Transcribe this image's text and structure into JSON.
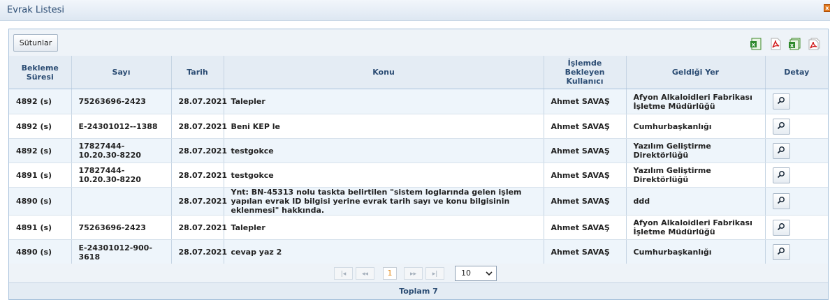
{
  "window": {
    "title": "Evrak Listesi",
    "close_label": "x"
  },
  "toolbar": {
    "columns_button": "Sütunlar",
    "export_icons": [
      "excel-icon",
      "pdf-icon",
      "excel-all-icon",
      "pdf-all-icon"
    ]
  },
  "table": {
    "headers": [
      "Bekleme Süresi",
      "Sayı",
      "Tarih",
      "Konu",
      "İşlemde Bekleyen Kullanıcı",
      "Geldiği Yer",
      "Detay"
    ],
    "rows": [
      {
        "wait": "4892 (s)",
        "number": "75263696-2423",
        "date": "28.07.2021",
        "subject": "Talepler",
        "user": "Ahmet SAVAŞ",
        "origin": "Afyon Alkaloidleri Fabrikası İşletme Müdürlüğü"
      },
      {
        "wait": "4892 (s)",
        "number": "E-24301012--1388",
        "date": "28.07.2021",
        "subject": "Beni KEP le",
        "user": "Ahmet SAVAŞ",
        "origin": "Cumhurbaşkanlığı"
      },
      {
        "wait": "4892 (s)",
        "number": "17827444-10.20.30-8220",
        "date": "28.07.2021",
        "subject": "testgokce",
        "user": "Ahmet SAVAŞ",
        "origin": "Yazılım Geliştirme Direktörlüğü"
      },
      {
        "wait": "4891 (s)",
        "number": "17827444-10.20.30-8220",
        "date": "28.07.2021",
        "subject": "testgokce",
        "user": "Ahmet SAVAŞ",
        "origin": "Yazılım Geliştirme Direktörlüğü"
      },
      {
        "wait": "4890 (s)",
        "number": "",
        "date": "28.07.2021",
        "subject": "Ynt: BN-45313 nolu taskta belirtilen \"sistem loglarında gelen işlem yapılan evrak ID bilgisi yerine evrak tarih sayı ve konu bilgisinin eklenmesi\" hakkında.",
        "user": "Ahmet SAVAŞ",
        "origin": "ddd"
      },
      {
        "wait": "4891 (s)",
        "number": "75263696-2423",
        "date": "28.07.2021",
        "subject": "Talepler",
        "user": "Ahmet SAVAŞ",
        "origin": "Afyon Alkaloidleri Fabrikası İşletme Müdürlüğü"
      },
      {
        "wait": "4890 (s)",
        "number": "E-24301012-900-3618",
        "date": "28.07.2021",
        "subject": "cevap yaz 2",
        "user": "Ahmet SAVAŞ",
        "origin": "Cumhurbaşkanlığı"
      }
    ]
  },
  "pager": {
    "first": "|◂",
    "prev": "◂◂",
    "current_page": "1",
    "next": "▸▸",
    "last": "▸|",
    "page_size": "10"
  },
  "footer": {
    "total": "Toplam 7"
  }
}
